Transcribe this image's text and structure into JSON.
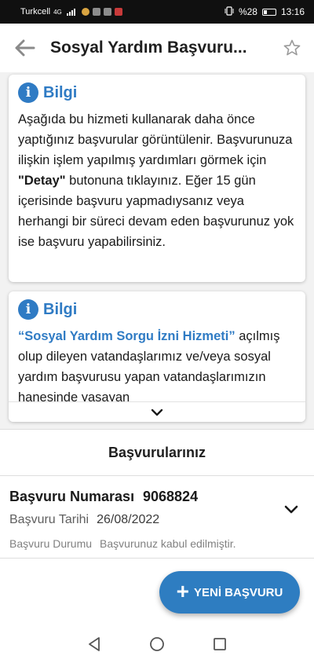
{
  "status_bar": {
    "carrier": "Turkcell",
    "network": "4G",
    "battery": "%28",
    "time": "13:16"
  },
  "app_bar": {
    "title": "Sosyal Yardım Başvuru...",
    "back_icon": "arrow-left-icon",
    "favorite_icon": "star-outline-icon"
  },
  "info_cards": [
    {
      "title": "Bilgi",
      "icon": "info-icon",
      "text_parts": {
        "p1": "Aşağıda bu hizmeti kullanarak daha önce yaptığınız başvurular görüntülenir. Başvurunuza ilişkin işlem yapılmış yardımları görmek için ",
        "bold": "\"Detay\"",
        "p2": " butonuna tıklayınız. Eğer 15 gün içerisinde başvuru yapmadıysanız veya herhangi bir süreci devam eden başvurunuz yok ise başvuru yapabilirsiniz."
      }
    },
    {
      "title": "Bilgi",
      "icon": "info-icon",
      "text_parts": {
        "link": "“Sosyal Yardım Sorgu İzni Hizmeti”",
        "p1": " açılmış olup dileyen vatandaşlarımız ve/veya sosyal yardım başvurusu yapan vatandaşlarımızın hanesinde yaşayan"
      },
      "expand_icon": "chevron-down-icon"
    }
  ],
  "applications": {
    "section_title": "Başvurularınız",
    "items": [
      {
        "number_label": "Başvuru Numarası",
        "number_value": "9068824",
        "date_label": "Başvuru Tarihi",
        "date_value": "26/08/2022",
        "status_label": "Başvuru Durumu",
        "status_value": "Başvurunuz kabul edilmiştir."
      }
    ]
  },
  "fab": {
    "label": "YENİ BAŞVURU",
    "icon": "plus-icon"
  },
  "colors": {
    "accent": "#2f7bc4",
    "fab": "#2e7dc1",
    "panel_bg": "#f2f2f2"
  }
}
